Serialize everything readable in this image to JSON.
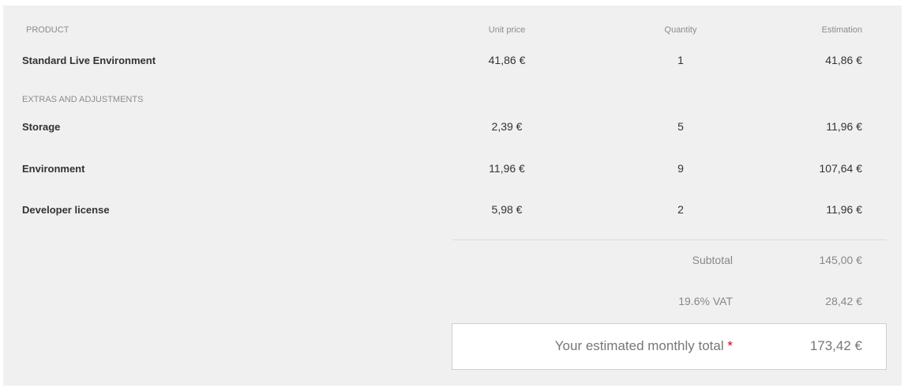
{
  "header": {
    "product": "PRODUCT",
    "unit_price": "Unit price",
    "quantity": "Quantity",
    "estimation": "Estimation"
  },
  "main_product": {
    "name": "Standard Live Environment",
    "unit_price": "41,86 €",
    "quantity": "1",
    "estimation": "41,86 €"
  },
  "extras_heading": "EXTRAS AND ADJUSTMENTS",
  "extras": [
    {
      "name": "Storage",
      "unit_price": "2,39 €",
      "quantity": "5",
      "estimation": "11,96 €"
    },
    {
      "name": "Environment",
      "unit_price": "11,96 €",
      "quantity": "9",
      "estimation": "107,64 €"
    },
    {
      "name": "Developer license",
      "unit_price": "5,98 €",
      "quantity": "2",
      "estimation": "11,96 €"
    }
  ],
  "summary": {
    "subtotal_label": "Subtotal",
    "subtotal_value": "145,00 €",
    "vat_label": "19.6% VAT",
    "vat_value": "28,42 €",
    "total_label": "Your estimated monthly total",
    "total_marker": "*",
    "total_value": "173,42 €"
  },
  "colors": {
    "panel_background": "#f0f0f0",
    "asterisk": "#d0021b"
  }
}
